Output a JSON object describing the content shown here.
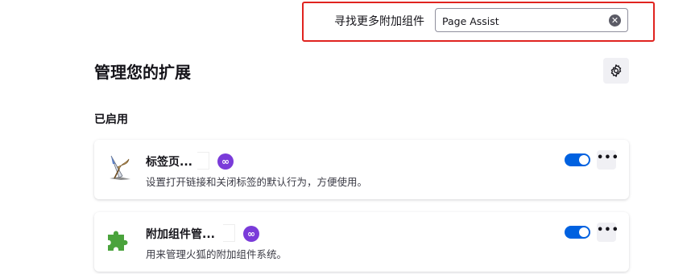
{
  "search": {
    "label": "寻找更多附加组件",
    "value": "Page Assist",
    "clear_glyph": "✕",
    "highlight_color": "#e0231f"
  },
  "header": {
    "title": "管理您的扩展",
    "settings_icon": "gear-icon"
  },
  "section": {
    "title": "已启用"
  },
  "extensions": [
    {
      "name": "标签页...",
      "description": "设置打开链接和关闭标签的默认行为，方便使用。",
      "icon": "quill-pen-icon",
      "badge": "∞",
      "enabled": true,
      "more_label": "•••"
    },
    {
      "name": "附加组件管...",
      "description": "用来管理火狐的附加组件系统。",
      "icon": "puzzle-piece-icon",
      "badge": "∞",
      "enabled": true,
      "more_label": "•••"
    }
  ],
  "colors": {
    "accent": "#0061e0",
    "badge": "#7a3bd9",
    "puzzle": "#4aa33c"
  }
}
